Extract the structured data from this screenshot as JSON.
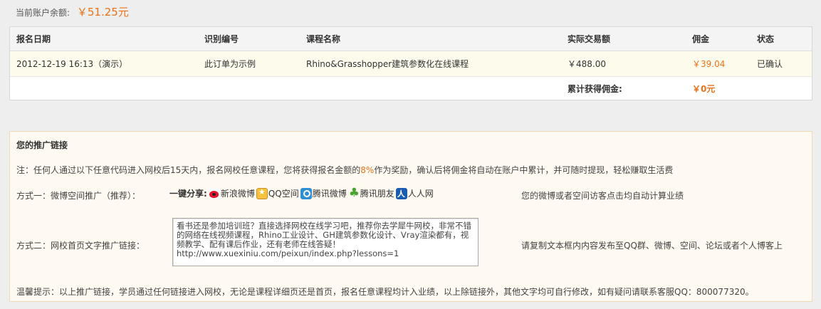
{
  "balance": {
    "label": "当前账户余额:",
    "amount": "￥51.25元"
  },
  "table": {
    "headers": [
      "报名日期",
      "识别编号",
      "课程名称",
      "实际交易额",
      "佣金",
      "状态"
    ],
    "rows": [
      {
        "date": "2012-12-19 16:13（演示）",
        "id": "此订单为示例",
        "course": "Rhino&Grasshopper建筑参数化在线课程",
        "amount": "￥488.00",
        "commission": "￥39.04",
        "status": "已确认"
      }
    ],
    "footer": {
      "label": "累计获得佣金:",
      "value": "￥0元"
    }
  },
  "promo": {
    "title": "您的推广链接",
    "note_prefix": "注：任何人通过以下任意代码进入网校后15天内，报名网校任意课程，您将获得报名金额的",
    "note_pct": "8%",
    "note_suffix": "作为奖励，确认后将佣金将自动在账户中累计，并可随时提现，轻松赚取生活费",
    "method1": {
      "label": "方式一：微博空间推广（推荐）：",
      "share_label": "一键分享:",
      "services": [
        {
          "icon": "sina-weibo-icon",
          "label": "新浪微博"
        },
        {
          "icon": "qzone-icon",
          "label": "QQ空间"
        },
        {
          "icon": "tencent-weibo-icon",
          "label": "腾讯微博"
        },
        {
          "icon": "pengyou-icon",
          "label": "腾讯朋友"
        },
        {
          "icon": "renren-icon",
          "label": "人人网"
        }
      ],
      "tip": "您的微博或者空间访客点击均自动计算业绩"
    },
    "method2": {
      "label": "方式二：网校首页文字推广链接：",
      "text": "看书还是参加培训班？直接选择网校在线学习吧，推荐你去学犀牛网校，非常不错的网络在线视频课程，Rhino工业设计、GH建筑参数化设计、Vray渲染都有，视频教学、配有课后作业，还有老师在线答疑！\nhttp://www.xuexiniu.com/peixun/index.php?lessons=1",
      "tip": "请复制文本框内内容发布至QQ群、微博、空间、论坛或者个人博客上"
    },
    "warm_tip": "温馨提示：以上推广链接，学员通过任何链接进入网校，无论是课程详细页还是首页，报名任意课程均计入业绩，以上除链接外，其他文字均可自行修改，如有疑问请联系客服QQ：800077320。"
  }
}
